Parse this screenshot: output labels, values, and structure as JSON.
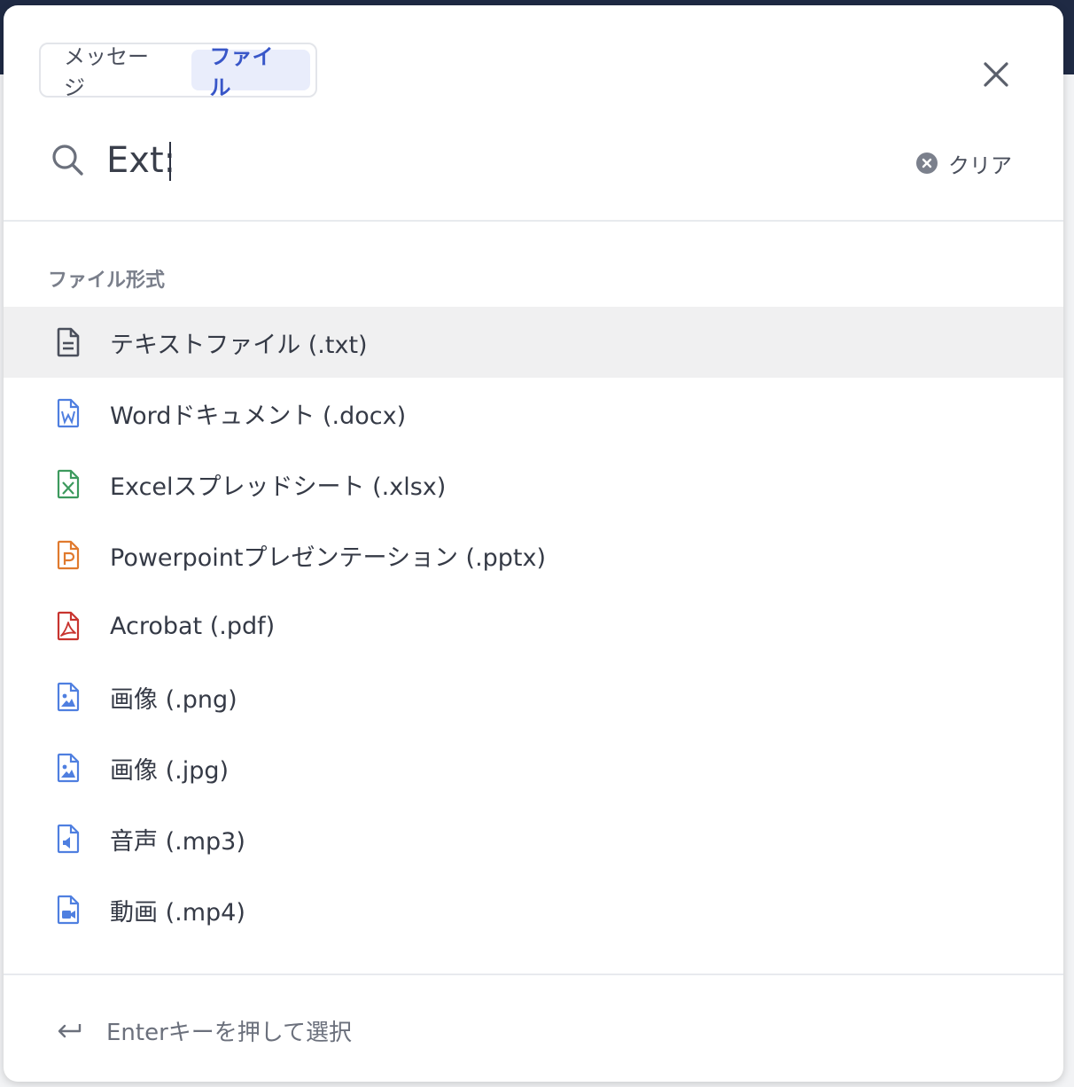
{
  "tabs": [
    {
      "label": "メッセージ",
      "active": false
    },
    {
      "label": "ファイル",
      "active": true
    }
  ],
  "search": {
    "value": "Ext:",
    "clear_label": "クリア"
  },
  "section": {
    "title": "ファイル形式"
  },
  "file_types": [
    {
      "label": "テキストファイル (.txt)",
      "icon": "text-file-icon",
      "color": "#4a4f5c",
      "selected": true
    },
    {
      "label": "Wordドキュメント (.docx)",
      "icon": "word-file-icon",
      "color": "#4f7fe0",
      "selected": false
    },
    {
      "label": "Excelスプレッドシート (.xlsx)",
      "icon": "excel-file-icon",
      "color": "#3d9a5e",
      "selected": false
    },
    {
      "label": "Powerpointプレゼンテーション (.pptx)",
      "icon": "powerpoint-file-icon",
      "color": "#e07a2e",
      "selected": false
    },
    {
      "label": "Acrobat (.pdf)",
      "icon": "pdf-file-icon",
      "color": "#c8342f",
      "selected": false
    },
    {
      "label": "画像 (.png)",
      "icon": "image-file-icon",
      "color": "#4f7fe0",
      "selected": false
    },
    {
      "label": "画像 (.jpg)",
      "icon": "image-file-icon",
      "color": "#4f7fe0",
      "selected": false
    },
    {
      "label": "音声 (.mp3)",
      "icon": "audio-file-icon",
      "color": "#4f7fe0",
      "selected": false
    },
    {
      "label": "動画 (.mp4)",
      "icon": "video-file-icon",
      "color": "#4f7fe0",
      "selected": false
    }
  ],
  "footer": {
    "hint": "Enterキーを押して選択"
  }
}
